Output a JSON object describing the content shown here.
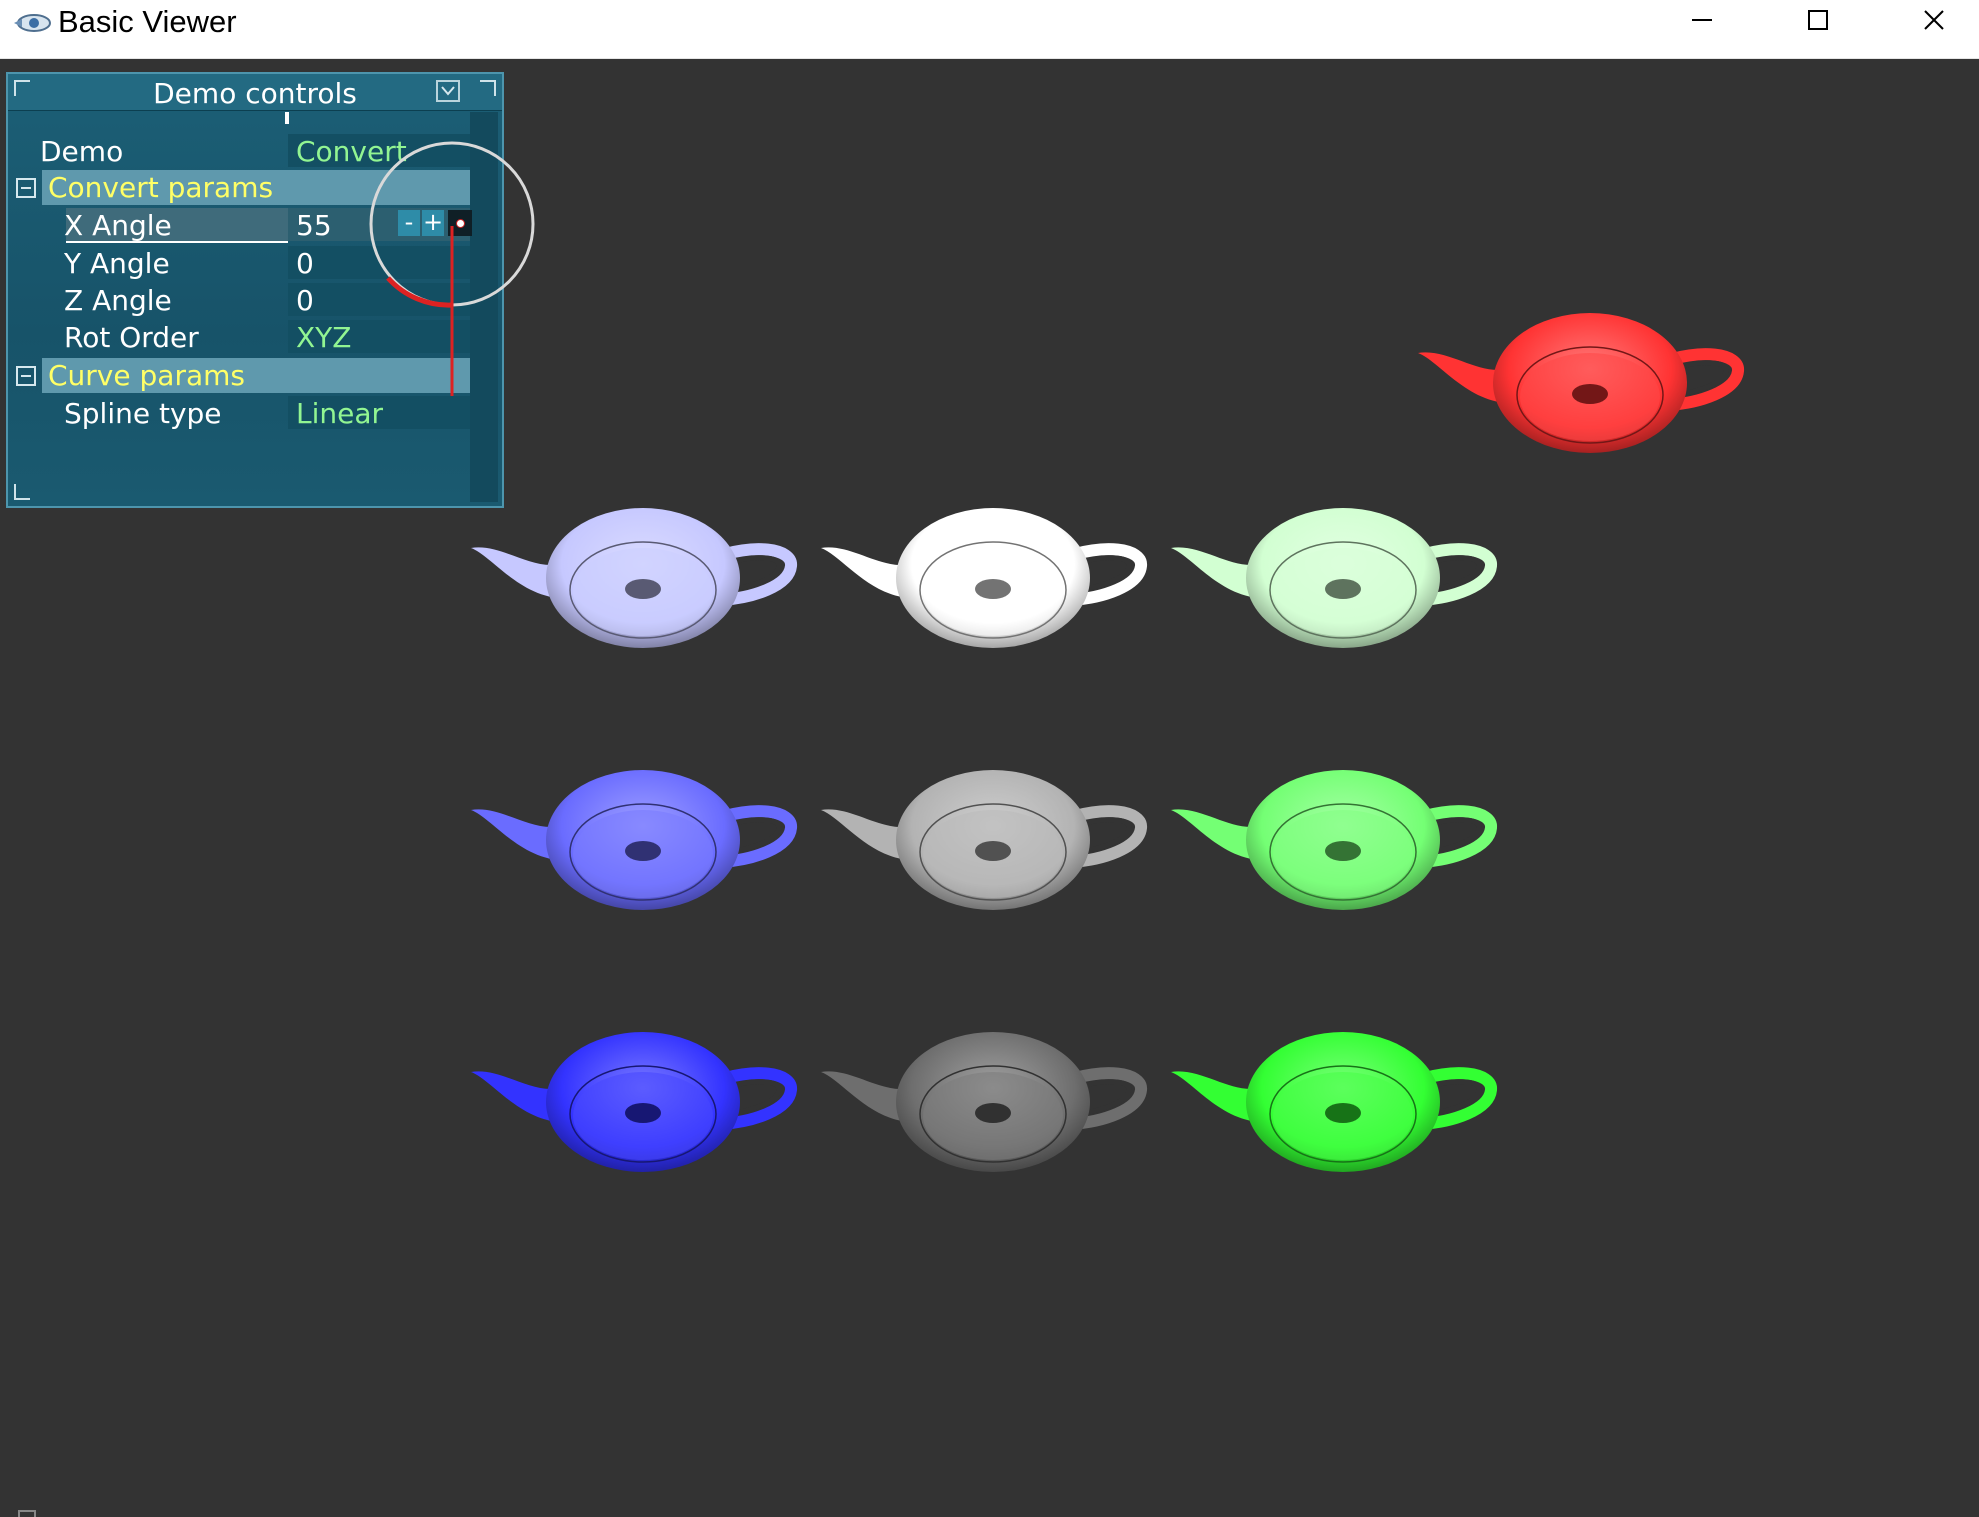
{
  "window": {
    "title": "Basic Viewer",
    "app_icon": "eye-app-icon",
    "controls": {
      "minimize_icon": "minimize-icon",
      "maximize_icon": "maximize-icon",
      "close_icon": "close-icon"
    }
  },
  "panel": {
    "title": "Demo controls",
    "iconify_icon": "chevron-down-box-icon",
    "rows": [
      {
        "label": "Demo",
        "value": "Convert"
      }
    ],
    "groups": [
      {
        "label": "Convert params",
        "toggle_icon": "collapse-icon",
        "rows": [
          {
            "label": "X Angle",
            "value": "55"
          },
          {
            "label": "Y Angle",
            "value": "0"
          },
          {
            "label": "Z Angle",
            "value": "0"
          },
          {
            "label": "Rot Order",
            "value": "XYZ"
          }
        ]
      },
      {
        "label": "Curve params",
        "toggle_icon": "collapse-icon",
        "rows": [
          {
            "label": "Spline type",
            "value": "Linear"
          }
        ]
      }
    ],
    "spin_minus": "-",
    "spin_plus": "+",
    "colors": {
      "background": "#175369",
      "group_header": "#5f99ad",
      "group_text": "#ffff66",
      "enum_value": "#92f592"
    }
  },
  "scene": {
    "background": "#333333",
    "reference_teapot_color": "#ff3333",
    "teapot_grid": [
      [
        "#c6c8ff",
        "#ffffff",
        "#d2ffd2"
      ],
      [
        "#6a6cff",
        "#b3b3b3",
        "#74ff74"
      ],
      [
        "#3333ff",
        "#6e6e6e",
        "#33ff33"
      ]
    ]
  }
}
